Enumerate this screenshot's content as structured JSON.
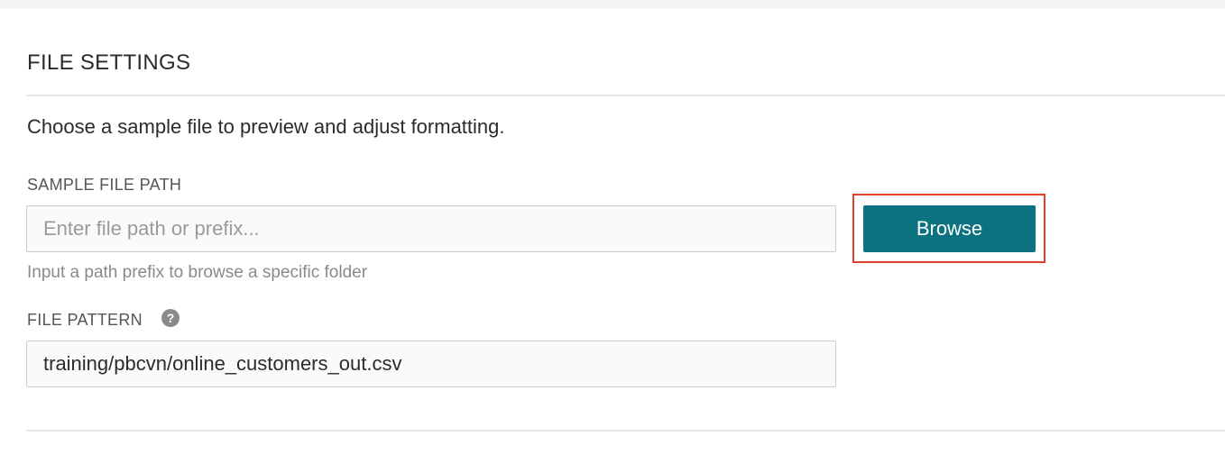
{
  "section": {
    "title": "FILE SETTINGS",
    "description": "Choose a sample file to preview and adjust formatting."
  },
  "sample_file_path": {
    "label": "SAMPLE FILE PATH",
    "placeholder": "Enter file path or prefix...",
    "value": "",
    "hint": "Input a path prefix to browse a specific folder",
    "browse_label": "Browse"
  },
  "file_pattern": {
    "label": "FILE PATTERN",
    "help_glyph": "?",
    "value": "training/pbcvn/online_customers_out.csv"
  },
  "colors": {
    "accent": "#0d7280",
    "highlight": "#e0402a"
  }
}
